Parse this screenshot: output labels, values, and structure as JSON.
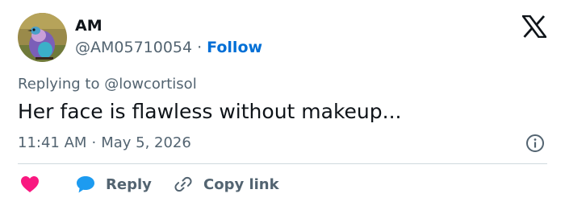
{
  "author": {
    "name": "AM",
    "handle": "@AM05710054",
    "separator": "·",
    "follow_label": "Follow"
  },
  "brand": {
    "logo_icon": "x-logo-icon"
  },
  "tweet": {
    "replying_to": "Replying to @lowcortisol",
    "text": "Her face is flawless without makeup...",
    "time": "11:41 AM",
    "time_separator": "·",
    "date": "May 5, 2026"
  },
  "actions": {
    "like_icon": "heart-icon",
    "reply_label": "Reply",
    "reply_icon": "speech-bubble-icon",
    "copy_link_label": "Copy link",
    "copy_link_icon": "link-icon",
    "info_icon": "info-icon"
  },
  "colors": {
    "follow": "#006fd6",
    "heart": "#f91880",
    "reply_bubble": "#1d9bf0",
    "secondary_text": "#536471"
  }
}
